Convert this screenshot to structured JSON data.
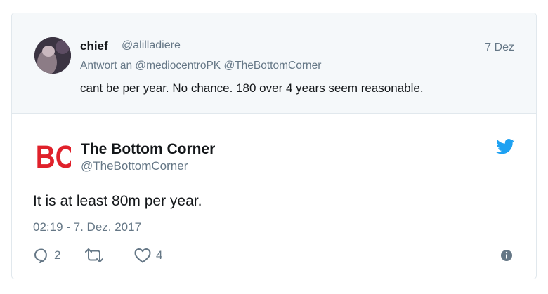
{
  "parent_tweet": {
    "author_name": "chief",
    "author_handle": "@alilladiere",
    "date": "7 Dez",
    "reply_prefix": "Antwort an",
    "reply_to_1": "@mediocentroPK",
    "reply_to_2": "@TheBottomCorner",
    "text": "cant be per year. No chance. 180 over 4 years seem reasonable."
  },
  "main_tweet": {
    "logo_text": "BC",
    "author_name": "The Bottom Corner",
    "author_handle": "@TheBottomCorner",
    "text": "It is at least 80m per year.",
    "timestamp": "02:19 - 7. Dez. 2017",
    "replies": "2",
    "likes": "4"
  },
  "colors": {
    "brand_red": "#e0212b",
    "twitter_blue": "#1da1f2",
    "muted": "#657786"
  },
  "icons": [
    "reply-icon",
    "retweet-icon",
    "like-icon",
    "info-icon",
    "twitter-bird-icon"
  ]
}
